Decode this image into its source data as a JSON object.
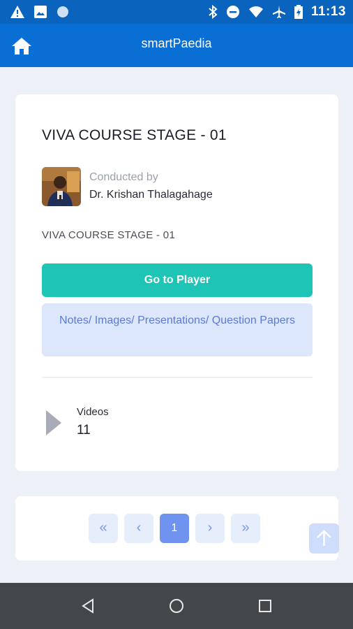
{
  "status_bar": {
    "time": "11:13",
    "left_icons": [
      "alert-icon",
      "image-icon",
      "circle-icon"
    ],
    "right_icons": [
      "bluetooth-icon",
      "dnd-icon",
      "wifi-icon",
      "airplane-icon",
      "battery-icon"
    ]
  },
  "app_bar": {
    "title": "smartPaedia",
    "home_icon": "home-icon"
  },
  "course": {
    "title": "VIVA COURSE STAGE - 01",
    "conducted_label": "Conducted by",
    "instructor": "Dr. Krishan Thalagahage",
    "subtitle": "VIVA COURSE STAGE - 01",
    "player_button": "Go to Player",
    "notes_button": "Notes/ Images/ Presentations/ Question Papers",
    "videos_label": "Videos",
    "videos_count": "11"
  },
  "pagination": {
    "first": "«",
    "prev": "‹",
    "current": "1",
    "next": "›",
    "last": "»"
  },
  "colors": {
    "primary": "#0a6fd4",
    "accent": "#1ec4b5",
    "page_bg": "#eef0f8"
  }
}
